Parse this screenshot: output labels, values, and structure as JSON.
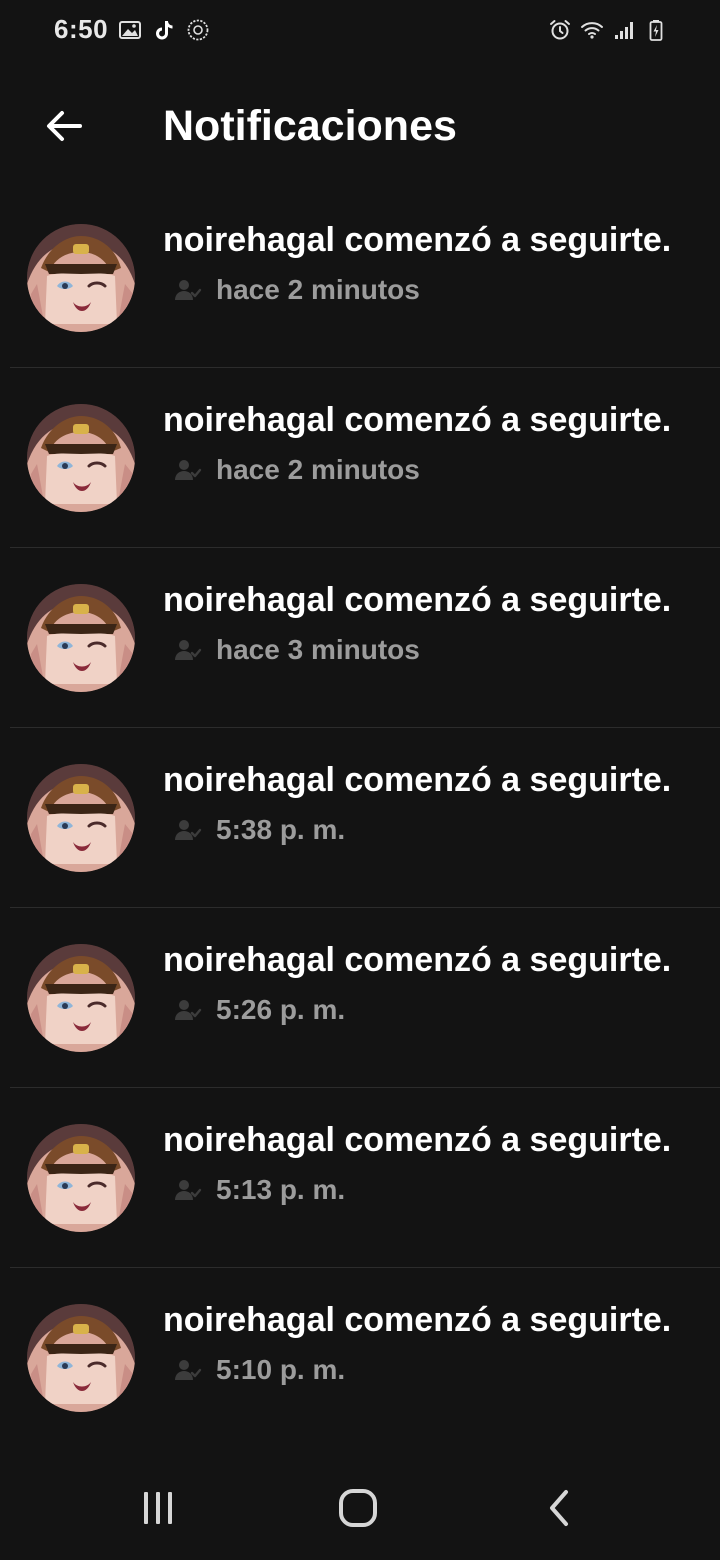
{
  "status_bar": {
    "time": "6:50",
    "left_icons": [
      "gallery-icon",
      "tiktok-icon",
      "settings-circle-icon"
    ],
    "right_icons": [
      "alarm-icon",
      "wifi-icon",
      "signal-icon",
      "battery-charging-icon"
    ]
  },
  "header": {
    "title": "Notificaciones",
    "back_icon": "arrow-left-icon"
  },
  "notifications": [
    {
      "text": "noirehagal comenzó a seguirte.",
      "time": "hace 2 minutos"
    },
    {
      "text": "noirehagal comenzó a seguirte.",
      "time": "hace 2 minutos"
    },
    {
      "text": "noirehagal comenzó a seguirte.",
      "time": "hace 3 minutos"
    },
    {
      "text": "noirehagal comenzó a seguirte.",
      "time": "5:38 p. m."
    },
    {
      "text": "noirehagal comenzó a seguirte.",
      "time": "5:26 p. m."
    },
    {
      "text": "noirehagal comenzó a seguirte.",
      "time": "5:13 p. m."
    },
    {
      "text": "noirehagal comenzó a seguirte.",
      "time": "5:10 p. m."
    }
  ],
  "nav_bar": {
    "icons": [
      "recents-icon",
      "home-icon",
      "back-icon"
    ]
  },
  "colors": {
    "background": "#131313",
    "text_primary": "#ffffff",
    "text_secondary": "#9c9c9c",
    "divider": "#2c2c2c"
  }
}
